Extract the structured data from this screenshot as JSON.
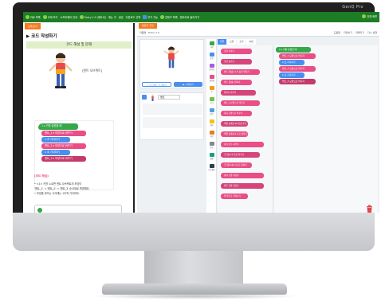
{
  "brand": "GenQ Pro",
  "topbar": {
    "items": [
      "자료 목록",
      "교재 보기",
      "소프트웨어 안내",
      "Entry 2.0 (엔트리)",
      "메뉴 가",
      "생성",
      "다운로드 선택",
      "부가 기능",
      "콘텐츠 목록",
      "엔트리로 돌아가기"
    ],
    "right": "전체 화면"
  },
  "left_tab": "교재 보기",
  "left": {
    "heading": "▶ 코드 작성하기",
    "banner": "코드 해설 및 문제",
    "character_label": "[엔트 오브젝트]",
    "blocks": [
      {
        "text": "1 ▸ 키를 눌렀을 때",
        "kind": "start"
      },
      {
        "text": "엔트_1 ▾ 모양으로 바꾸기",
        "kind": "pink"
      },
      {
        "text": "1 초 기다리기",
        "kind": "blue"
      },
      {
        "text": "엔트_2 ▾ 모양으로 바꾸기",
        "kind": "pink"
      },
      {
        "text": "1 초 기다리기",
        "kind": "blue"
      },
      {
        "text": "엔트_3 ▾ 모양으로 바꾸기",
        "kind": "dark"
      }
    ],
    "notes_title": "[코드 해설]",
    "notes": [
      "• <1> 키를 누르면 엔트 오브젝트의 모양이",
      "'엔트_1' → '엔트_2' → '엔트_3' 순서대로 변경해요.",
      "• 모양을 바꾸는 사이에는 1초씩 기다려요."
    ]
  },
  "right_tab": "엔트리 코딩",
  "right": {
    "title": "작품명 : Entry 2.0",
    "tools": [
      "도움말",
      "저장하기",
      "되돌리기",
      "다시 실행"
    ],
    "palette_tabs": [
      "블록",
      "모양",
      "소리",
      "속성"
    ],
    "object_name": "엔트",
    "add_object": "+ 오브젝트 추가하기",
    "start_btn": "▶ 시작하기",
    "categories": [
      {
        "label": "시작",
        "color": "#35a84a"
      },
      {
        "label": "흐름",
        "color": "#4a8ef0"
      },
      {
        "label": "움직임",
        "color": "#a55de0"
      },
      {
        "label": "생김새",
        "color": "#e94f86"
      },
      {
        "label": "붓",
        "color": "#f39c12"
      },
      {
        "label": "소리",
        "color": "#76c043"
      },
      {
        "label": "판단",
        "color": "#4aa3df"
      },
      {
        "label": "계산",
        "color": "#f1c40f"
      },
      {
        "label": "자료",
        "color": "#e67e22"
      },
      {
        "label": "함수",
        "color": "#7f8c8d"
      },
      {
        "label": "확장",
        "color": "#16a085"
      },
      {
        "label": "하드웨어",
        "color": "#2c3e50"
      }
    ],
    "palette_blocks": [
      "모양 보이기",
      "모양 숨기기",
      "엔트 을(를) 4 초 동안 말하기",
      "엔트 을(를) 말하기",
      "말하기 지우기",
      "엔트_2 모양으로 바꾸기",
      "다음 모양으로 바꾸기",
      "색깔 효과를 10 만큼 주기",
      "색깔 효과를 0 으로 정하기",
      "효과 모두 지우기",
      "크기를 10 만큼 바꾸기",
      "크기를 100 (으)로 정하기",
      "상하 모양 뒤집기",
      "좌우 모양 뒤집기",
      "맨 앞으로 가져오기"
    ],
    "workspace_blocks": [
      "1 ▸ 키를 눌렀을 때",
      "엔트_1 모양으로 바꾸기",
      "1 초 기다리기",
      "엔트_2 모양으로 바꾸기",
      "1 초 기다리기",
      "엔트_3 모양으로 바꾸기"
    ]
  }
}
